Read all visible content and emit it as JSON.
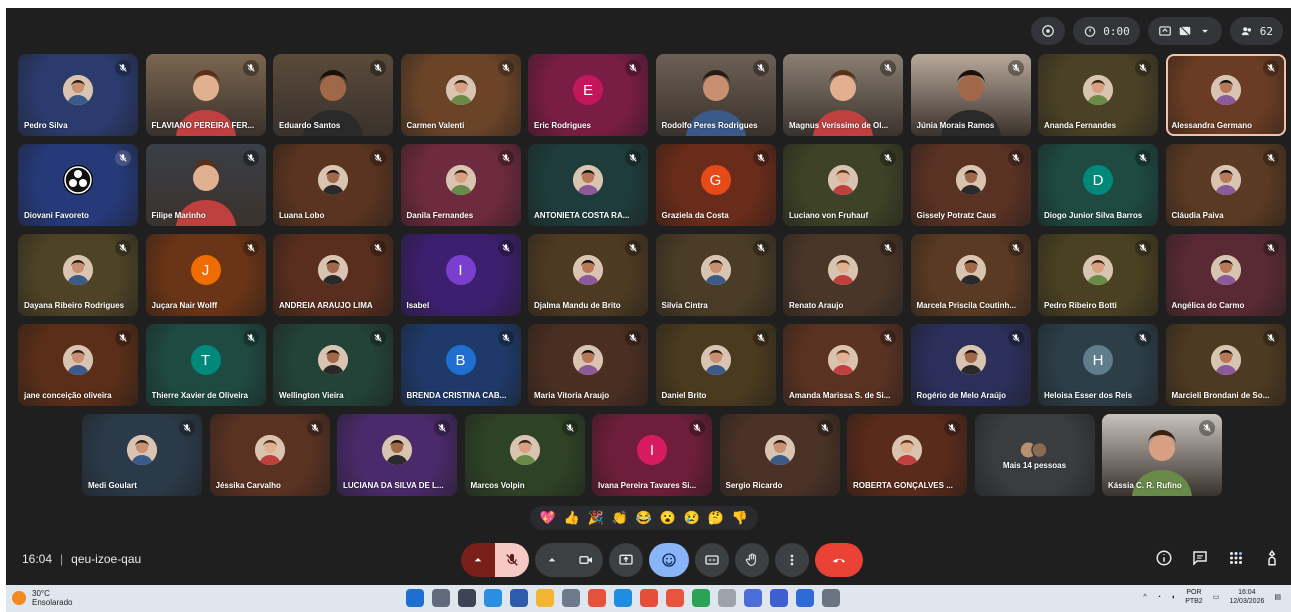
{
  "topbar": {
    "timer": "0:00",
    "participants_count": "62"
  },
  "participants": [
    {
      "name": "Pedro Silva",
      "row": 0,
      "col": 0,
      "bg": "#2b3b6e",
      "kind": "avatar"
    },
    {
      "name": "FLAVIANO PEREIRA FER...",
      "row": 0,
      "col": 1,
      "bg": "#7b6650",
      "kind": "video"
    },
    {
      "name": "Eduardo Santos",
      "row": 0,
      "col": 2,
      "bg": "#5a4a3a",
      "kind": "video"
    },
    {
      "name": "Carmen Valenti",
      "row": 0,
      "col": 3,
      "bg": "#6b4428",
      "kind": "avatar"
    },
    {
      "name": "Eric Rodrigues",
      "row": 0,
      "col": 4,
      "bg": "#7a1d45",
      "kind": "letter",
      "letter": "E",
      "letter_bg": "#c2185b"
    },
    {
      "name": "Rodolfo Peres Rodrigues",
      "row": 0,
      "col": 5,
      "bg": "#6d6055",
      "kind": "video"
    },
    {
      "name": "Magnus Veríssimo de Ol...",
      "row": 0,
      "col": 6,
      "bg": "#8a7f72",
      "kind": "video"
    },
    {
      "name": "Júnia Morais Ramos",
      "row": 0,
      "col": 7,
      "bg": "#b8a89a",
      "kind": "video"
    },
    {
      "name": "Ananda Fernandes",
      "row": 0,
      "col": 8,
      "bg": "#4a4126",
      "kind": "avatar"
    },
    {
      "name": "Alessandra Germano",
      "row": 0,
      "col": 9,
      "bg": "#6a3c23",
      "kind": "avatar",
      "selected": true
    },
    {
      "name": "Diovani Favoreto",
      "row": 1,
      "col": 0,
      "bg": "#263a7a",
      "kind": "obs"
    },
    {
      "name": "Filipe Marinho",
      "row": 1,
      "col": 1,
      "bg": "#3a3f48",
      "kind": "video"
    },
    {
      "name": "Luana Lobo",
      "row": 1,
      "col": 2,
      "bg": "#5a3420",
      "kind": "avatar"
    },
    {
      "name": "Danila Fernandes",
      "row": 1,
      "col": 3,
      "bg": "#6e2a3e",
      "kind": "avatar"
    },
    {
      "name": "ANTONIETA COSTA RA...",
      "row": 1,
      "col": 4,
      "bg": "#1f3c3c",
      "kind": "avatar"
    },
    {
      "name": "Graziela da Costa",
      "row": 1,
      "col": 5,
      "bg": "#6a2c1a",
      "kind": "letter",
      "letter": "G",
      "letter_bg": "#e64a19"
    },
    {
      "name": "Luciano von Fruhauf",
      "row": 1,
      "col": 6,
      "bg": "#3e4226",
      "kind": "avatar"
    },
    {
      "name": "Gissely Potratz Caus",
      "row": 1,
      "col": 7,
      "bg": "#5a3224",
      "kind": "avatar"
    },
    {
      "name": "Diogo Junior Silva Barros",
      "row": 1,
      "col": 8,
      "bg": "#1e4a42",
      "kind": "letter",
      "letter": "D",
      "letter_bg": "#00897b"
    },
    {
      "name": "Cláudia Paiva",
      "row": 1,
      "col": 9,
      "bg": "#5a3a22",
      "kind": "avatar"
    },
    {
      "name": "Dayana Ribeiro Rodrigues",
      "row": 2,
      "col": 0,
      "bg": "#4e4326",
      "kind": "avatar"
    },
    {
      "name": "Juçara Nair Wolff",
      "row": 2,
      "col": 1,
      "bg": "#6a3416",
      "kind": "letter",
      "letter": "J",
      "letter_bg": "#ef6c00"
    },
    {
      "name": "ANDREIA ARAUJO LIMA",
      "row": 2,
      "col": 2,
      "bg": "#5a2e1e",
      "kind": "avatar"
    },
    {
      "name": "Isabel",
      "row": 2,
      "col": 3,
      "bg": "#3c1f6e",
      "kind": "letter",
      "letter": "I",
      "letter_bg": "#7b3fd0"
    },
    {
      "name": "Djalma Mandu de Brito",
      "row": 2,
      "col": 4,
      "bg": "#4e3a22",
      "kind": "avatar"
    },
    {
      "name": "Silvia Cintra",
      "row": 2,
      "col": 5,
      "bg": "#4a3c26",
      "kind": "avatar"
    },
    {
      "name": "Renato Araujo",
      "row": 2,
      "col": 6,
      "bg": "#4a3628",
      "kind": "avatar"
    },
    {
      "name": "Marcela Priscila Coutinh...",
      "row": 2,
      "col": 7,
      "bg": "#5a3a22",
      "kind": "avatar"
    },
    {
      "name": "Pedro Ribeiro Botti",
      "row": 2,
      "col": 8,
      "bg": "#4a4122",
      "kind": "avatar"
    },
    {
      "name": "Angélica do Carmo",
      "row": 2,
      "col": 9,
      "bg": "#5a2a34",
      "kind": "avatar"
    },
    {
      "name": "jane conceição oliveira",
      "row": 3,
      "col": 0,
      "bg": "#5a2e18",
      "kind": "avatar"
    },
    {
      "name": "Thierre Xavier de Oliveira",
      "row": 3,
      "col": 1,
      "bg": "#1e4a42",
      "kind": "letter",
      "letter": "T",
      "letter_bg": "#00897b"
    },
    {
      "name": "Wellington Vieira",
      "row": 3,
      "col": 2,
      "bg": "#234238",
      "kind": "avatar"
    },
    {
      "name": "BRENDA CRISTINA CAB...",
      "row": 3,
      "col": 3,
      "bg": "#1f3a6a",
      "kind": "letter",
      "letter": "B",
      "letter_bg": "#1e6fd0"
    },
    {
      "name": "Maria Vitoria Araujo",
      "row": 3,
      "col": 4,
      "bg": "#4a2e22",
      "kind": "avatar"
    },
    {
      "name": "Daniel Brito",
      "row": 3,
      "col": 5,
      "bg": "#4a3a1e",
      "kind": "avatar"
    },
    {
      "name": "Amanda Marissa S. de Si...",
      "row": 3,
      "col": 6,
      "bg": "#5a3222",
      "kind": "avatar"
    },
    {
      "name": "Rogério de Melo Araújo",
      "row": 3,
      "col": 7,
      "bg": "#2b2f5a",
      "kind": "avatar"
    },
    {
      "name": "Heloisa Esser dos Reis",
      "row": 3,
      "col": 8,
      "bg": "#2c3e48",
      "kind": "letter",
      "letter": "H",
      "letter_bg": "#607d8b"
    },
    {
      "name": "Marcieli Brondani de So...",
      "row": 3,
      "col": 9,
      "bg": "#4e3a22",
      "kind": "avatar"
    },
    {
      "name": "Medi Goulart",
      "row": 4,
      "col": 0,
      "bg": "#2b3a48",
      "kind": "avatar"
    },
    {
      "name": "Jéssika Carvalho",
      "row": 4,
      "col": 1,
      "bg": "#5a3222",
      "kind": "avatar"
    },
    {
      "name": "LUCIANA DA SILVA DE L...",
      "row": 4,
      "col": 2,
      "bg": "#4a2a6a",
      "kind": "avatar"
    },
    {
      "name": "Marcos Volpin",
      "row": 4,
      "col": 3,
      "bg": "#2e4226",
      "kind": "avatar"
    },
    {
      "name": "Ivana Pereira Tavares Si...",
      "row": 4,
      "col": 4,
      "bg": "#6e1e3a",
      "kind": "letter",
      "letter": "I",
      "letter_bg": "#d81b60"
    },
    {
      "name": "Sergio Ricardo",
      "row": 4,
      "col": 5,
      "bg": "#4a3226",
      "kind": "avatar"
    },
    {
      "name": "ROBERTA GONÇALVES ...",
      "row": 4,
      "col": 6,
      "bg": "#5a2a1a",
      "kind": "avatar"
    },
    {
      "name": "Mais 14 pessoas",
      "row": 4,
      "col": 7,
      "bg": "#3a3c40",
      "kind": "more"
    },
    {
      "name": "Kássia C. R. Rufino",
      "row": 4,
      "col": 8,
      "bg": "#c8c2bc",
      "kind": "video"
    }
  ],
  "reactions": [
    "💖",
    "👍",
    "🎉",
    "👏",
    "😂",
    "😮",
    "😢",
    "🤔",
    "👎"
  ],
  "meeting": {
    "time": "16:04",
    "code": "qeu-izoe-qau"
  },
  "taskbar": {
    "temp": "30°C",
    "weather": "Ensolarado",
    "lang1": "POR",
    "lang2": "PTB2",
    "clock_time": "16:04",
    "clock_date": "12/03/2026"
  },
  "colors": {
    "meet_bg": "#1f1f1f",
    "hangup": "#ea4335",
    "mic_off_bg": "#f6c9c4",
    "emoji_active": "#8ab4f8"
  }
}
